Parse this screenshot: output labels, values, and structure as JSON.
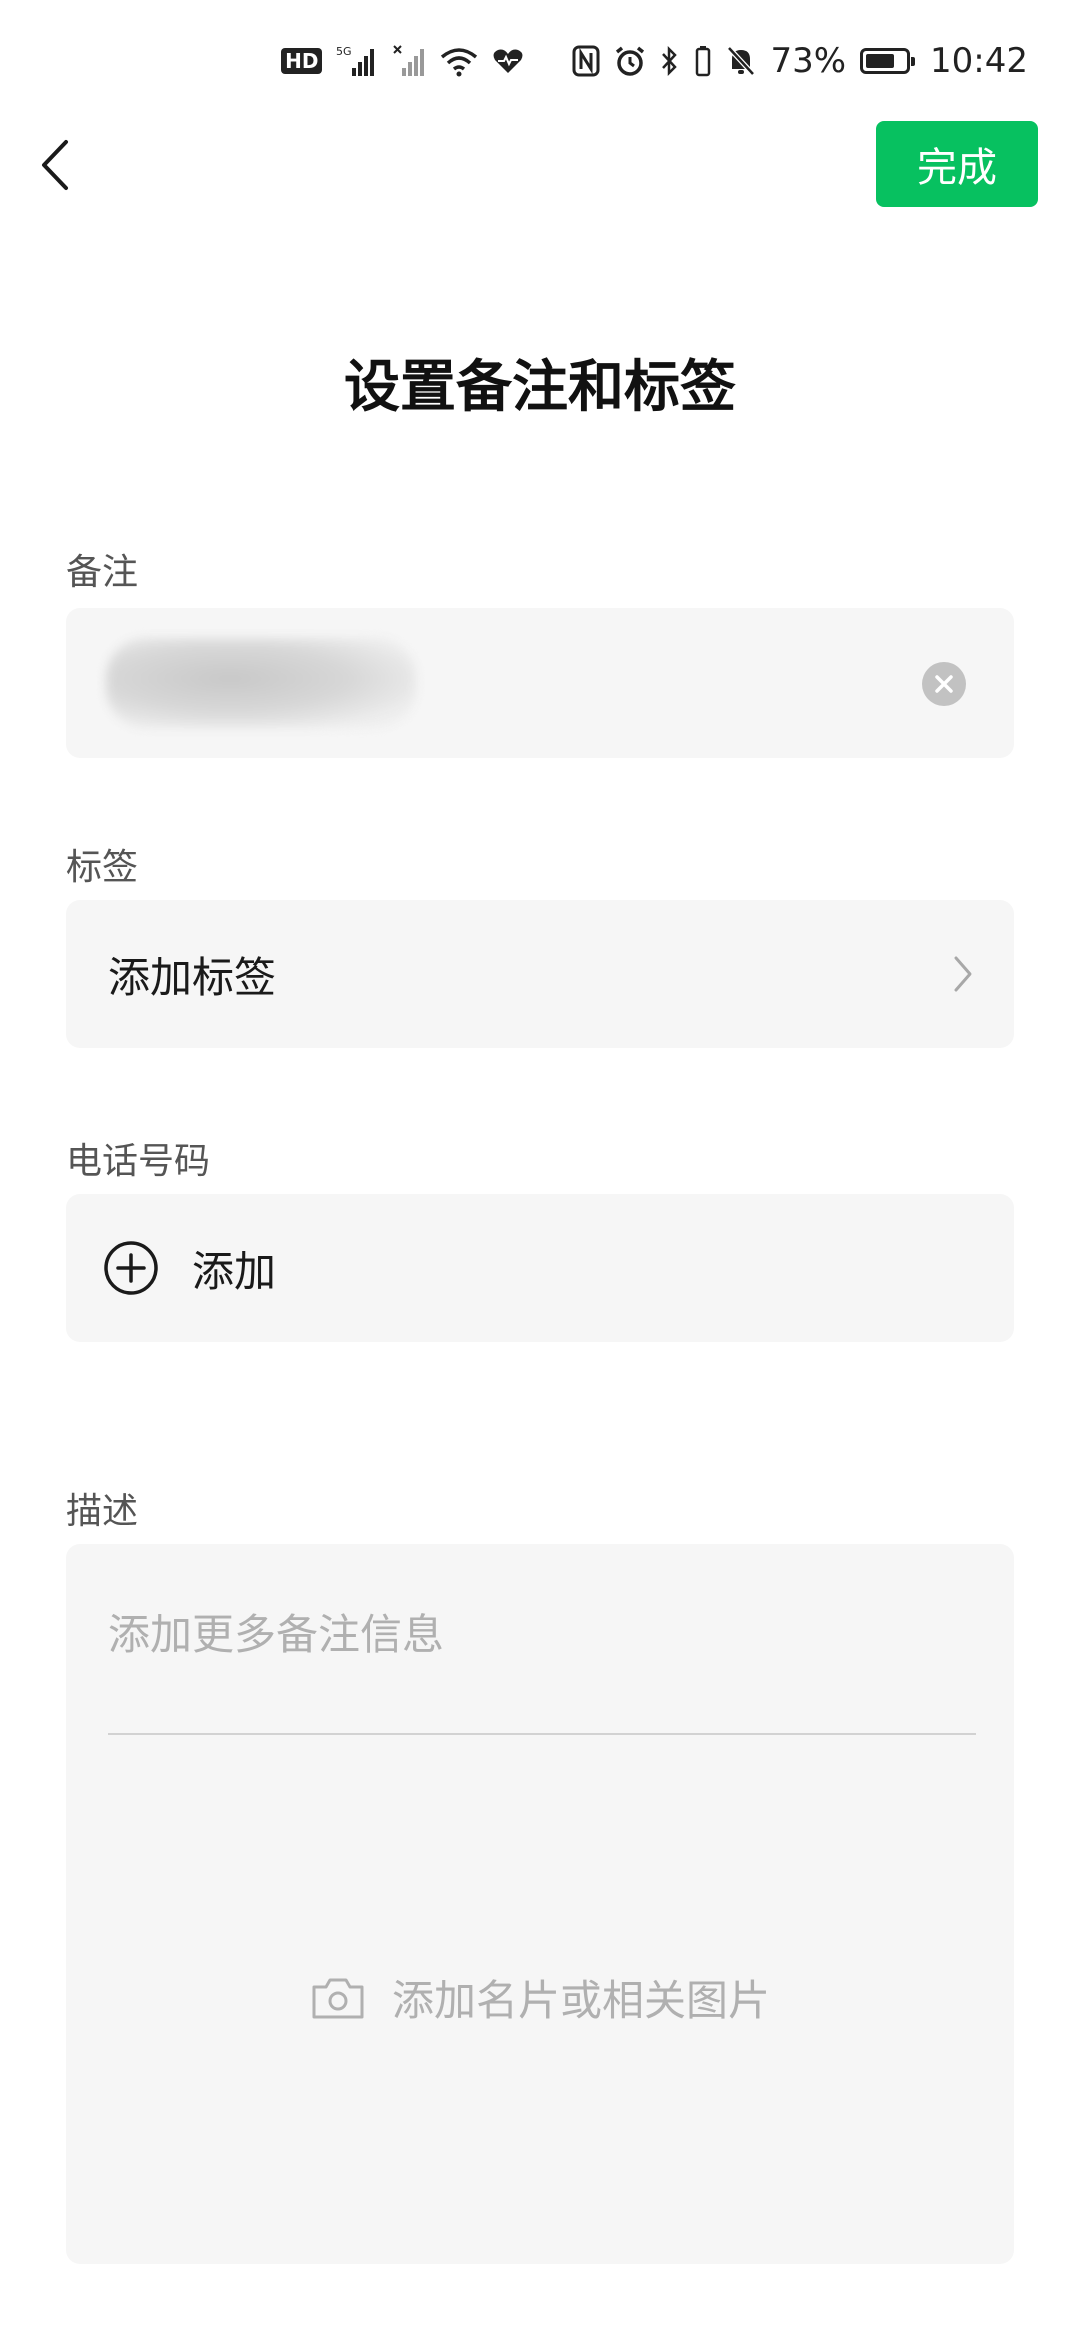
{
  "status_bar": {
    "hd_label": "HD",
    "signal_label": "5G",
    "battery_text": "73%",
    "battery_level": 0.73,
    "time": "10:42"
  },
  "nav": {
    "done_label": "完成"
  },
  "title": "设置备注和标签",
  "remark": {
    "label": "备注"
  },
  "tags": {
    "label": "标签",
    "action": "添加标签"
  },
  "phone": {
    "label": "电话号码",
    "action": "添加"
  },
  "description": {
    "label": "描述",
    "placeholder": "添加更多备注信息",
    "photo_action": "添加名片或相关图片"
  },
  "colors": {
    "accent": "#07c160",
    "field_bg": "#f6f6f6",
    "placeholder": "#b0b0b0"
  },
  "icons": [
    "back-chevron-icon",
    "clear-icon",
    "chevron-right-icon",
    "plus-circle-icon",
    "camera-icon"
  ]
}
